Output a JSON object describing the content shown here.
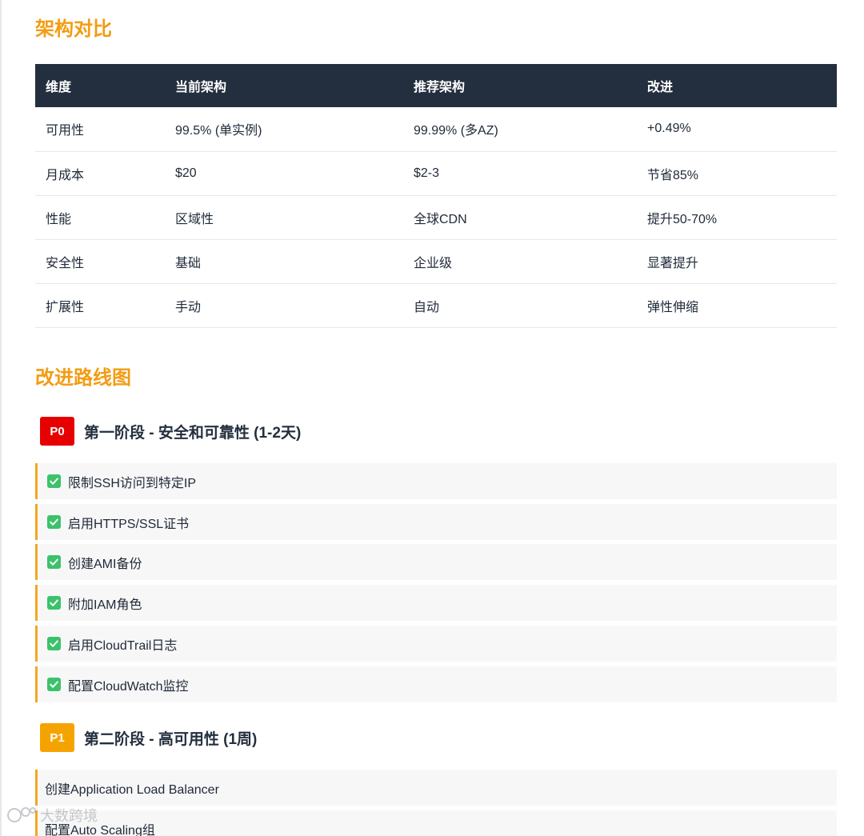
{
  "architecture": {
    "title": "架构对比",
    "headers": [
      "维度",
      "当前架构",
      "推荐架构",
      "改进"
    ],
    "rows": [
      [
        "可用性",
        "99.5% (单实例)",
        "99.99% (多AZ)",
        "+0.49%"
      ],
      [
        "月成本",
        "$20",
        "$2-3",
        "节省85%"
      ],
      [
        "性能",
        "区域性",
        "全球CDN",
        "提升50-70%"
      ],
      [
        "安全性",
        "基础",
        "企业级",
        "显著提升"
      ],
      [
        "扩展性",
        "手动",
        "自动",
        "弹性伸缩"
      ]
    ]
  },
  "roadmap": {
    "title": "改进路线图",
    "phases": [
      {
        "badge": "P0",
        "title": "第一阶段 - 安全和可靠性 (1-2天)",
        "tasks": [
          "限制SSH访问到特定IP",
          "启用HTTPS/SSL证书",
          "创建AMI备份",
          "附加IAM角色",
          "启用CloudTrail日志",
          "配置CloudWatch监控"
        ]
      },
      {
        "badge": "P1",
        "title": "第二阶段 - 高可用性 (1周)",
        "tasks": [
          "创建Application Load Balancer",
          "配置Auto Scaling组"
        ]
      }
    ]
  },
  "watermark": {
    "text": "大数跨境"
  },
  "colors": {
    "accent": "#f39c12",
    "header_bg": "#232f3e",
    "p0": "#e60000",
    "p1": "#f5a300",
    "check": "#3cc26a"
  }
}
